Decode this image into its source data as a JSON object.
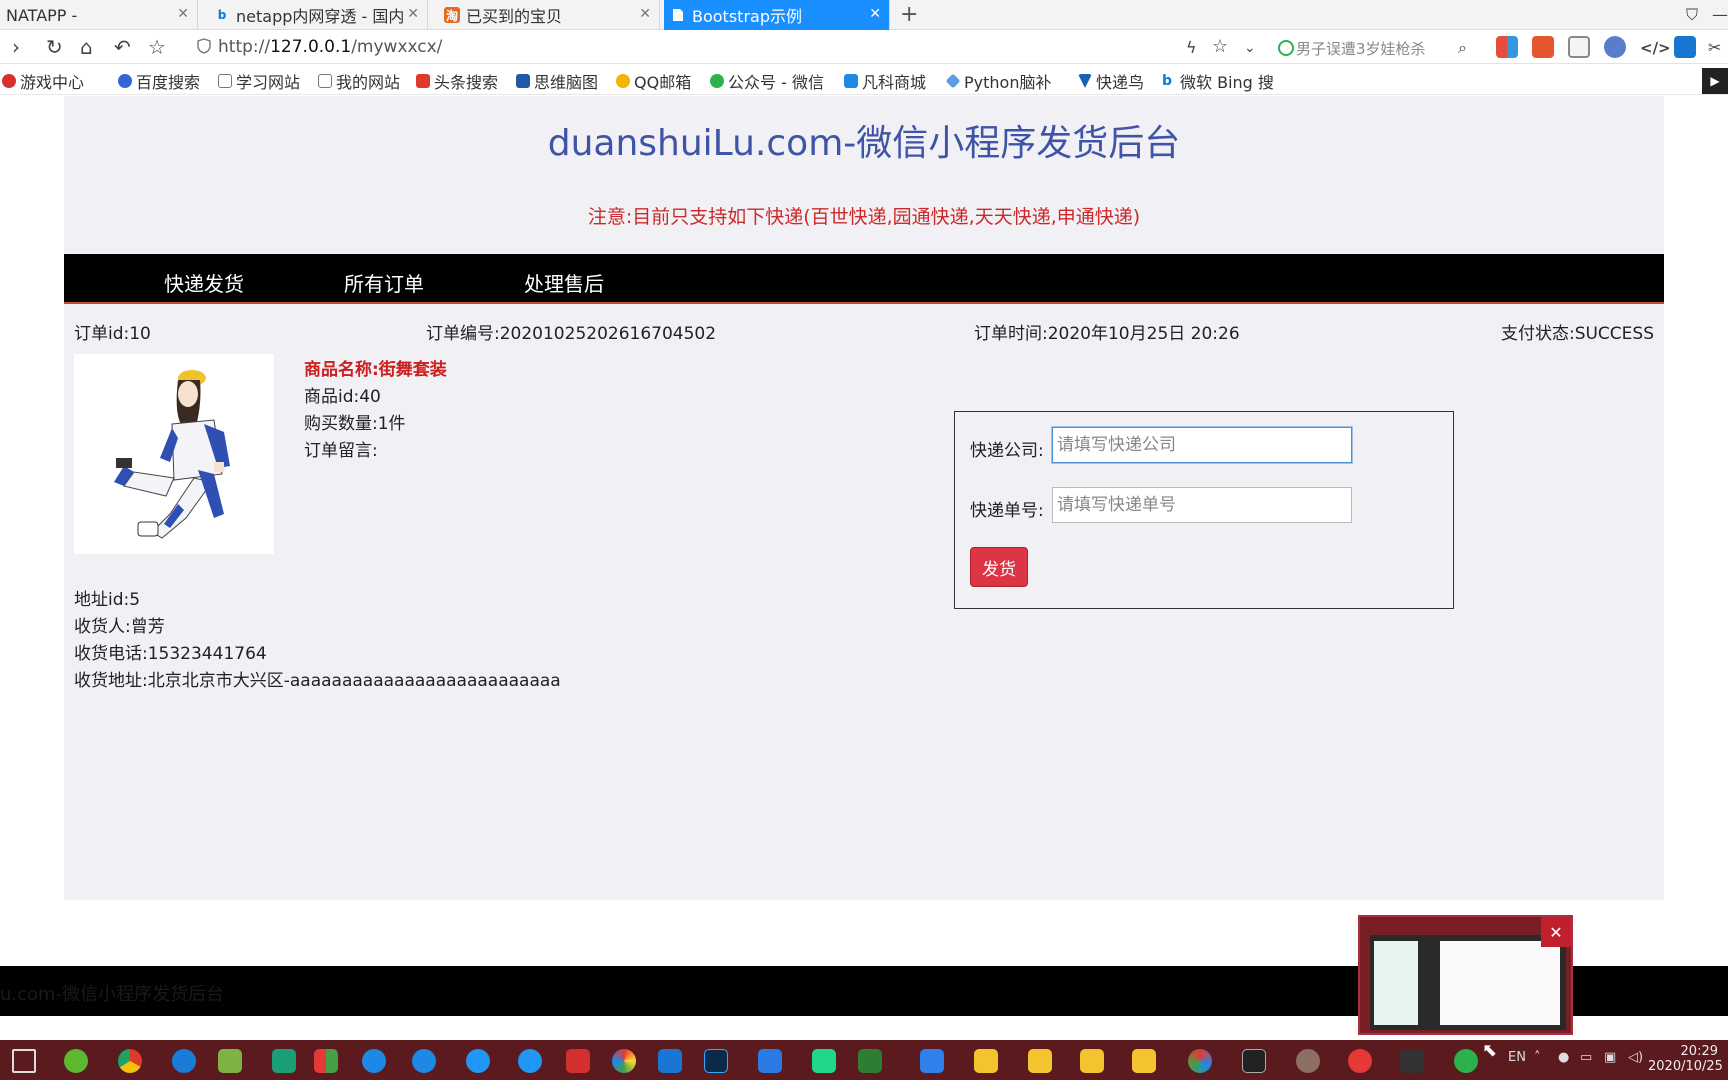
{
  "browser": {
    "tabs": [
      {
        "label": "NATAPP -",
        "icon": "natapp-icon"
      },
      {
        "label": "netapp内网穿透 - 国内",
        "icon": "bing-icon"
      },
      {
        "label": "已买到的宝贝",
        "icon": "taobao-icon"
      },
      {
        "label": "Bootstrap示例",
        "icon": "page-icon",
        "active": true
      }
    ],
    "new_tab": "+",
    "url_prefix": "http://",
    "url_host": "127.0.0.1",
    "url_path": "/mywxxcx/",
    "search_hint": "男子误遭3岁娃枪杀",
    "bookmarks": [
      "游戏中心",
      "百度搜索",
      "学习网站",
      "我的网站",
      "头条搜索",
      "思维脑图",
      "QQ邮箱",
      "公众号 - 微信",
      "凡科商城",
      "Python脑补",
      "快递鸟",
      "微软 Bing 搜"
    ],
    "accent": "#1a8fff"
  },
  "header": {
    "title": "duanshuiLu.com-微信小程序发货后台",
    "notice": "注意:目前只支持如下快递(百世快递,园通快递,天天快递,申通快递)",
    "title_color": "#3f54a6",
    "notice_color": "#cc2a2a"
  },
  "nav": {
    "items": [
      "快递发货",
      "所有订单",
      "处理售后"
    ]
  },
  "order": {
    "id": "订单id:10",
    "number": "订单编号:20201025202616704502",
    "time": "订单时间:2020年10月25日 20:26",
    "pay_status": "支付状态:SUCCESS",
    "product_name": "商品名称:街舞套装",
    "product_id": "商品id:40",
    "quantity": "购买数量:1件",
    "remark": "订单留言:",
    "address_id": "地址id:5",
    "receiver": "收货人:曾芳",
    "phone": "收货电话:15323441764",
    "address": "收货地址:北京北京市大兴区-aaaaaaaaaaaaaaaaaaaaaaaaaa"
  },
  "shipping": {
    "company_label": "快递公司:",
    "company_placeholder": "请填写快递公司",
    "number_label": "快递单号:",
    "number_placeholder": "请填写快递单号",
    "submit_label": "发货",
    "button_color": "#dc3545"
  },
  "footer": {
    "text": "u.com-微信小程序发货后台"
  },
  "taskbar": {
    "time": "20:29",
    "date": "2020/10/25",
    "lang": "EN"
  }
}
